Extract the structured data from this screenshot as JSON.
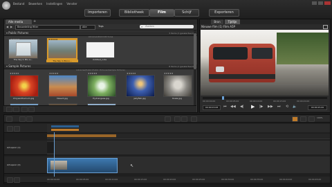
{
  "app": {
    "menu": [
      "Bestand",
      "Bewerken",
      "Instellingen",
      "Venster"
    ],
    "modes": {
      "importeren": "Importeren",
      "bibliotheek": "Bibliotheek",
      "film": "Film",
      "schijf": "Schijf",
      "exporteren": "Exporteren"
    },
    "active_mode": "Film"
  },
  "library": {
    "tab": "Alle media",
    "filter_label": "Beoordeling filter",
    "filter_value": "Alle",
    "sort_label": "Tags",
    "search_placeholder": "Zoeken",
    "sections": [
      {
        "title": "Public Pictures",
        "meta": "3 items (1 geselecteerd)",
        "subpath": "Libraries\\Public\\Pictures",
        "items": [
          {
            "caption": "The Sky in Blu Li...",
            "stars": "★★★★★"
          },
          {
            "caption": "The Sky in Blu Li...",
            "stars": "★★★★★"
          },
          {
            "caption": "Untitled_note",
            "stars": ""
          }
        ]
      },
      {
        "title": "Sample Pictures",
        "meta": "8 items (1 geselecteerd)",
        "subpath": "Libraries\\Public\\Public Pictures\\Sample Pictures",
        "items": [
          {
            "caption": "Chrysanthemum.jpg",
            "stars": "★★★★★"
          },
          {
            "caption": "Desert.jpg",
            "stars": "★★★★★"
          },
          {
            "caption": "Hydrangeas.jpg",
            "stars": "★★★★★"
          },
          {
            "caption": "Jellyfish.jpg",
            "stars": "★★★★★"
          },
          {
            "caption": "Koala.jpg",
            "stars": "★★★★★"
          }
        ]
      }
    ]
  },
  "player": {
    "tabs": [
      "Bron",
      "Tijdlijn"
    ],
    "title": "Nieuwe film (1) Film A5P",
    "timecodes": [
      "00:00:00.00",
      "00:00:05.00",
      "00:00:10.00",
      "00:00:15.00",
      "00:00:20.00",
      "00:00:25.00"
    ],
    "current_time": "00:00:03.08",
    "total_time": "00:00:25.00"
  },
  "timeline": {
    "ruler": [
      "00:00:00.00",
      "00:00:05.00",
      "00:00:10.00",
      "00:00:15.00",
      "00:00:20.00",
      "00:00:25.00",
      "00:00:30.00",
      "00:00:35.00",
      "00:00:40.00",
      "00:00:45.00"
    ],
    "tracks": [
      {
        "label": "A/V-spoor (1)"
      },
      {
        "label": "A/V-spoor (2)"
      }
    ],
    "zoom": "100%"
  },
  "colors": {
    "accent": "#d99a2b",
    "clip_blue": "#2d5f8f",
    "clip_orange": "#c07b2a",
    "playhead": "#6aa1d6"
  }
}
